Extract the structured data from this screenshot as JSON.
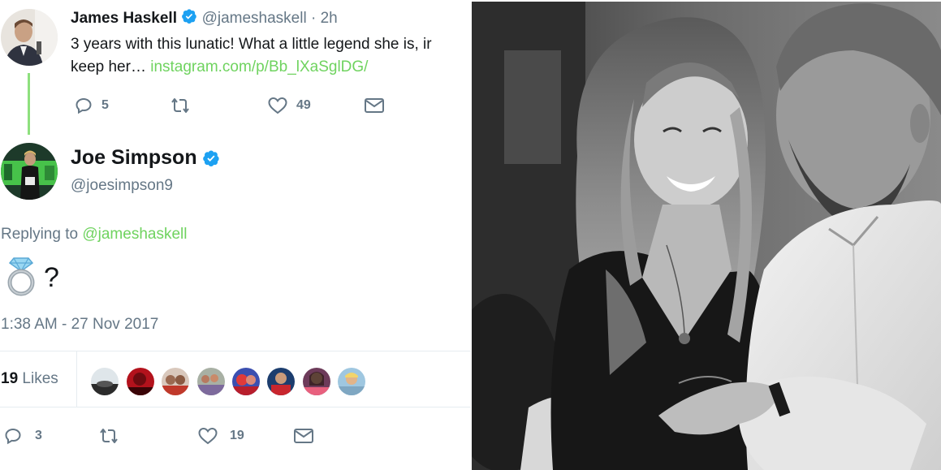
{
  "tweet1": {
    "name": "James Haskell",
    "handle": "@jameshaskell",
    "time": "· 2h",
    "text_line1": "3 years with this lunatic! What a little legend she is, ir",
    "text_line2": "keep her… ",
    "link": "instagram.com/p/Bb_lXaSglDG/",
    "replies": "5",
    "retweets": "",
    "likes": "49"
  },
  "tweet2": {
    "name": "Joe Simpson",
    "handle": "@joesimpson9",
    "replying_prefix": "Replying to ",
    "replying_handle": "@jameshaskell",
    "text": "?",
    "timestamp": "1:38 AM - 27 Nov 2017",
    "likes_count": "19",
    "likes_label": "Likes",
    "replies": "3",
    "retweets": "",
    "likes": "19"
  },
  "colors": {
    "link": "#6fd35f",
    "verified": "#1da1f2",
    "muted": "#657786",
    "thread_line": "#8ee07e"
  },
  "icons": [
    "verified-badge-icon",
    "reply-icon",
    "retweet-icon",
    "like-icon",
    "direct-message-icon",
    "ring-emoji-icon"
  ]
}
